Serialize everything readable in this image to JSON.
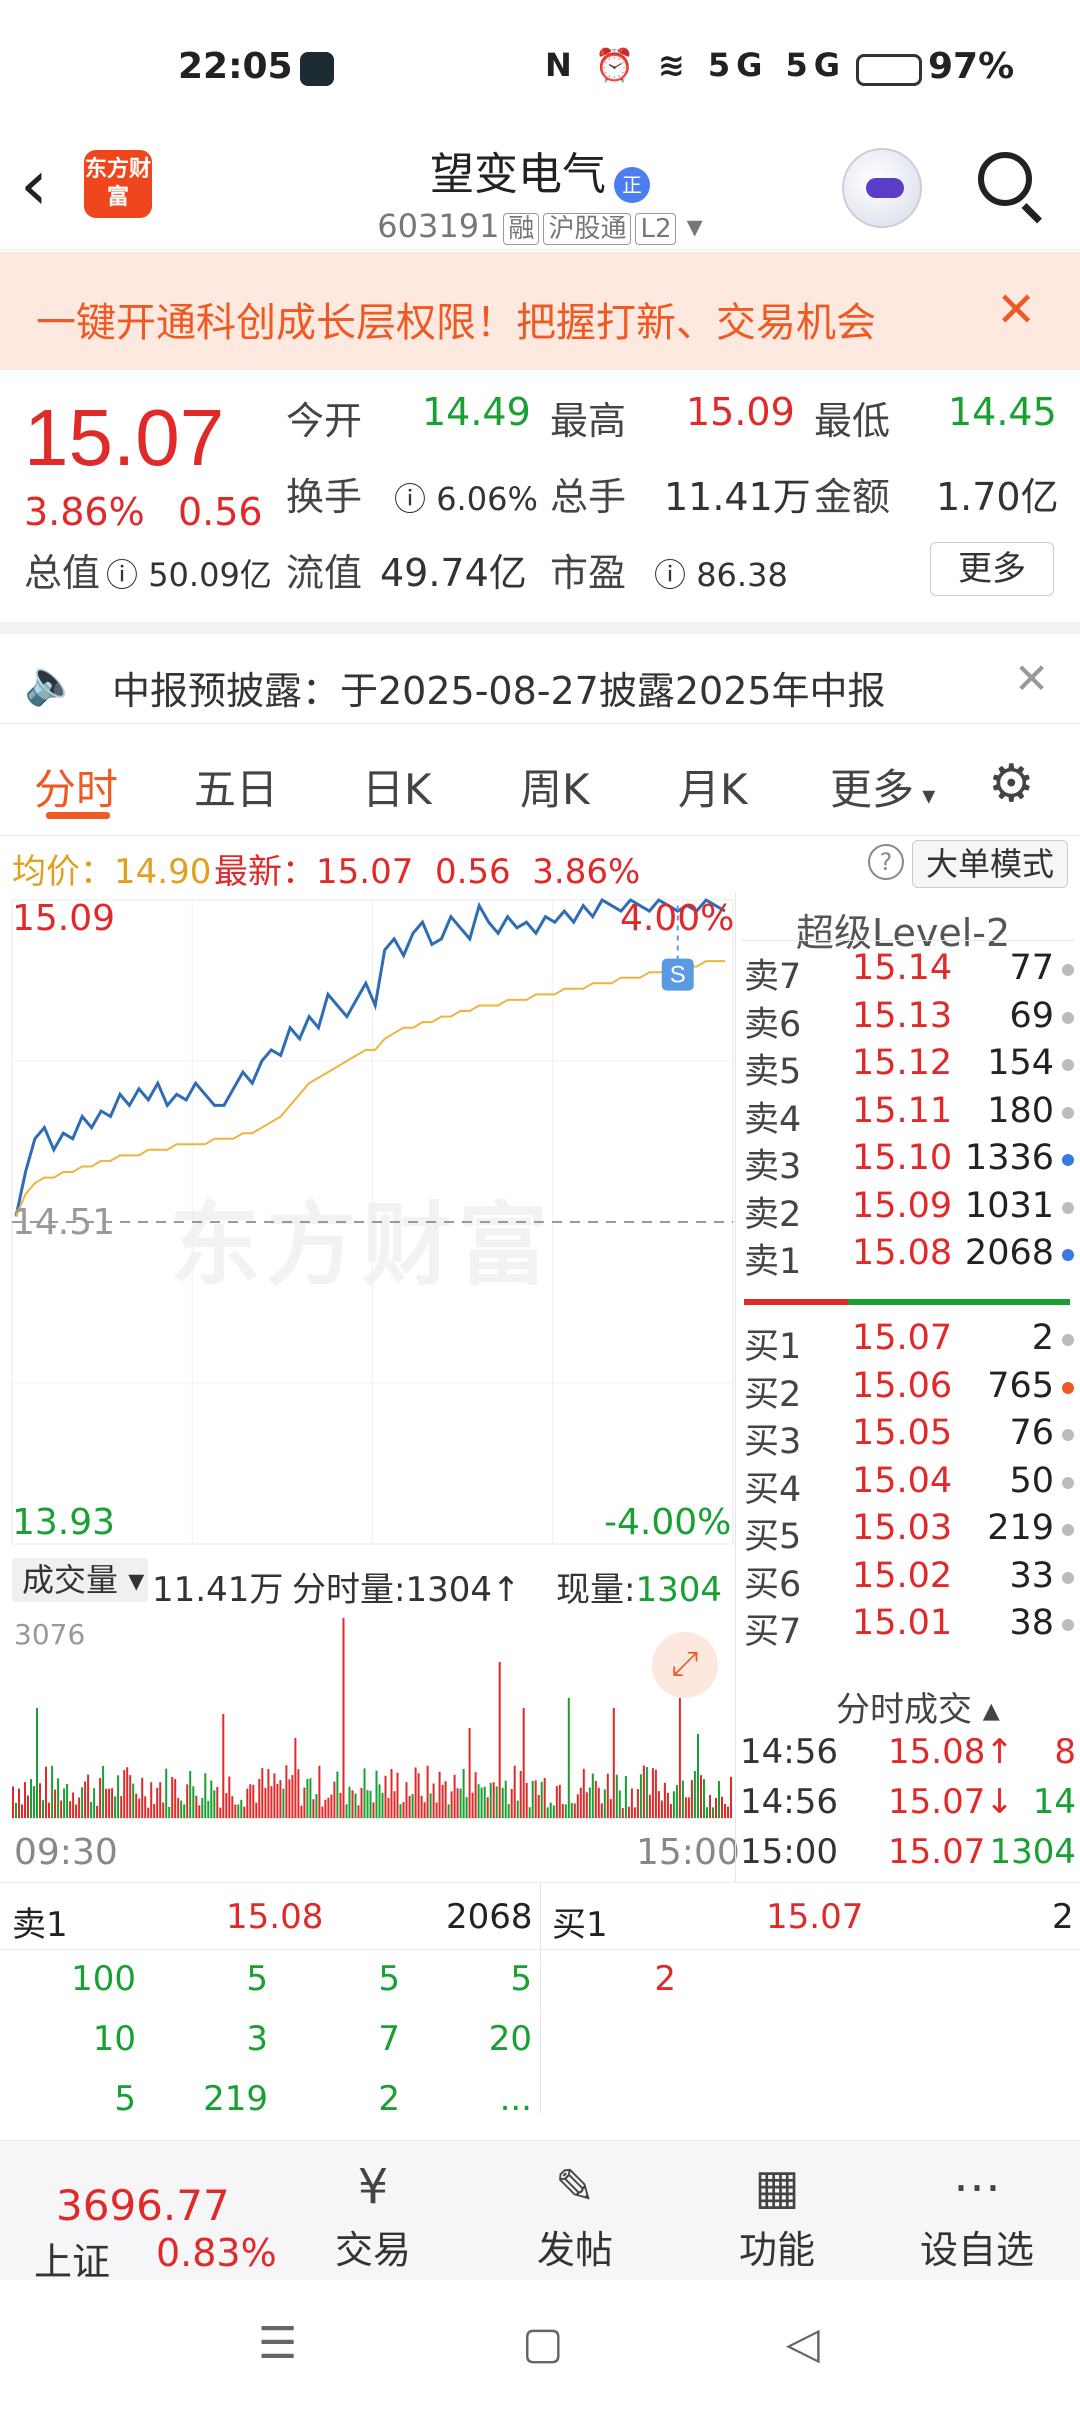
{
  "status_bar": {
    "time": "22:05",
    "signal_icons": "N ⏰ ≋ 5G 5G",
    "battery_pct": "97%"
  },
  "header": {
    "stock_name": "望变电气",
    "badge": "正",
    "stock_code": "603191",
    "tags": [
      "融",
      "沪股通",
      "L2"
    ],
    "logo_text": "东方财富"
  },
  "banner": {
    "text": "一键开通科创成长层权限！把握打新、交易机会"
  },
  "quote": {
    "price": "15.07",
    "change_pct": "3.86%",
    "change_abs": "0.56",
    "open_label": "今开",
    "open": "14.49",
    "high_label": "最高",
    "high": "15.09",
    "low_label": "最低",
    "low": "14.45",
    "turnover_label": "换手",
    "turnover": "6.06%",
    "volume_label": "总手",
    "volume": "11.41万",
    "amount_label": "金额",
    "amount": "1.70亿",
    "mktcap_label": "总值",
    "mktcap": "50.09亿",
    "float_label": "流值",
    "float": "49.74亿",
    "pe_label": "市盈",
    "pe": "86.38",
    "more_label": "更多"
  },
  "notice": {
    "text": "中报预披露：于2025-08-27披露2025年中报"
  },
  "tabs": [
    "分时",
    "五日",
    "日K",
    "周K",
    "月K",
    "更多"
  ],
  "chart_info": {
    "avg_label": "均价：",
    "avg": "14.90",
    "latest_label": "最新：",
    "latest": "15.07",
    "latest_chg": "0.56",
    "latest_pct": "3.86%",
    "mode_label": "大单模式"
  },
  "chart_data": {
    "type": "line",
    "title": "",
    "xlabel": "",
    "ylabel": "",
    "x_ticks": [
      "09:30",
      "15:00"
    ],
    "ylim": [
      13.93,
      15.09
    ],
    "y_ticks": [
      "15.09",
      "14.51",
      "13.93"
    ],
    "pct_ticks": [
      "4.00%",
      "-4.00%"
    ],
    "prev_close": 14.51,
    "series": [
      {
        "values": [
          14.52,
          14.6,
          14.66,
          14.68,
          14.64,
          14.67,
          14.66,
          14.7,
          14.68,
          14.71,
          14.7,
          14.74,
          14.72,
          14.75,
          14.73,
          14.76,
          14.72,
          14.74,
          14.73,
          14.76,
          14.74,
          14.72,
          14.72,
          14.75,
          14.78,
          14.76,
          14.8,
          14.82,
          14.81,
          14.86,
          14.84,
          14.88,
          14.86,
          14.92,
          14.9,
          14.88,
          14.91,
          14.94,
          14.9,
          15.0,
          15.02,
          14.99,
          15.03,
          15.05,
          15.01,
          15.02,
          15.06,
          15.04,
          15.02,
          15.08,
          15.05,
          15.03,
          15.06,
          15.04,
          15.05,
          15.03,
          15.06,
          15.05,
          15.07,
          15.05,
          15.08,
          15.06,
          15.09,
          15.08,
          15.07,
          15.09,
          15.08,
          15.07,
          15.09,
          15.08,
          15.07,
          15.08,
          15.07,
          15.09,
          15.08,
          15.07
        ]
      },
      {
        "values": [
          14.52,
          14.56,
          14.58,
          14.59,
          14.59,
          14.6,
          14.6,
          14.61,
          14.61,
          14.62,
          14.62,
          14.63,
          14.63,
          14.63,
          14.64,
          14.64,
          14.64,
          14.65,
          14.65,
          14.65,
          14.65,
          14.66,
          14.66,
          14.66,
          14.67,
          14.67,
          14.68,
          14.69,
          14.7,
          14.72,
          14.74,
          14.76,
          14.77,
          14.78,
          14.79,
          14.8,
          14.81,
          14.82,
          14.82,
          14.84,
          14.85,
          14.86,
          14.86,
          14.87,
          14.87,
          14.88,
          14.88,
          14.89,
          14.89,
          14.9,
          14.9,
          14.9,
          14.91,
          14.91,
          14.91,
          14.92,
          14.92,
          14.92,
          14.93,
          14.93,
          14.93,
          14.94,
          14.94,
          14.94,
          14.95,
          14.95,
          14.95,
          14.96,
          14.96,
          14.96,
          14.97,
          14.97,
          14.97,
          14.98,
          14.98,
          14.98
        ]
      }
    ]
  },
  "volume": {
    "type_label": "成交量",
    "total": "11.41万",
    "minute_label": "分时量:",
    "minute": "1304",
    "current_label": "现量:",
    "current": "1304",
    "max": "3076",
    "time_start": "09:30",
    "time_end": "15:00"
  },
  "level2": {
    "title": "超级Level-2",
    "asks": [
      {
        "label": "卖7",
        "price": "15.14",
        "vol": "77"
      },
      {
        "label": "卖6",
        "price": "15.13",
        "vol": "69"
      },
      {
        "label": "卖5",
        "price": "15.12",
        "vol": "154"
      },
      {
        "label": "卖4",
        "price": "15.11",
        "vol": "180"
      },
      {
        "label": "卖3",
        "price": "15.10",
        "vol": "1336"
      },
      {
        "label": "卖2",
        "price": "15.09",
        "vol": "1031"
      },
      {
        "label": "卖1",
        "price": "15.08",
        "vol": "2068"
      }
    ],
    "bids": [
      {
        "label": "买1",
        "price": "15.07",
        "vol": "2"
      },
      {
        "label": "买2",
        "price": "15.06",
        "vol": "765"
      },
      {
        "label": "买3",
        "price": "15.05",
        "vol": "76"
      },
      {
        "label": "买4",
        "price": "15.04",
        "vol": "50"
      },
      {
        "label": "买5",
        "price": "15.03",
        "vol": "219"
      },
      {
        "label": "买6",
        "price": "15.02",
        "vol": "33"
      },
      {
        "label": "买7",
        "price": "15.01",
        "vol": "38"
      }
    ],
    "fenshi_title": "分时成交",
    "trades": [
      {
        "time": "14:56",
        "price": "15.08↑",
        "vol": "8"
      },
      {
        "time": "14:56",
        "price": "15.07↓",
        "vol": "14"
      },
      {
        "time": "15:00",
        "price": "15.07",
        "vol": "1304"
      }
    ]
  },
  "queue": {
    "sell_label": "卖1",
    "sell_price": "15.08",
    "sell_vol": "2068",
    "buy_label": "买1",
    "buy_price": "15.07",
    "buy_vol": "2",
    "sell_rows": [
      [
        "100",
        "5",
        "5",
        "5"
      ],
      [
        "10",
        "3",
        "7",
        "20"
      ],
      [
        "5",
        "219",
        "2",
        "..."
      ]
    ],
    "buy_rows": [
      [
        "2"
      ]
    ]
  },
  "bottom_bar": {
    "index_value": "3696.77",
    "index_name": "上证",
    "index_change": "0.83%",
    "items": [
      "交易",
      "发帖",
      "功能",
      "设自选"
    ]
  }
}
